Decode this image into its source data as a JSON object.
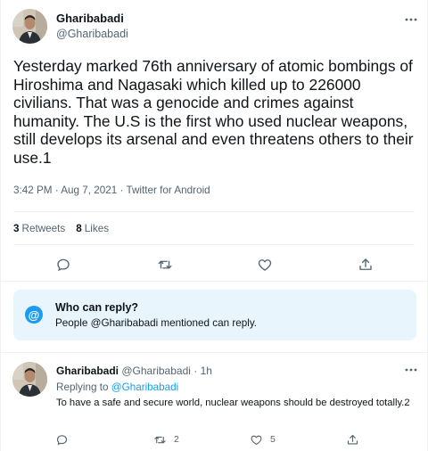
{
  "tweet": {
    "author_name": "Gharibabadi",
    "author_handle": "@Gharibabadi",
    "text": "Yesterday marked 76th anniversary of atomic bombings of Hiroshima and Nagasaki which killed up to 226000 civilians. That was a genocide and crimes against humanity. The U.S is the first who used nuclear weapons, still develops its arsenal and even threatens others to their use.1",
    "timestamp": "3:42 PM · Aug 7, 2021 · Twitter for Android",
    "retweets_count": "3",
    "retweets_label": "Retweets",
    "likes_count": "8",
    "likes_label": "Likes"
  },
  "reply_restriction": {
    "icon": "at-icon",
    "icon_glyph": "@",
    "title": "Who can reply?",
    "subtitle": "People @Gharibabadi mentioned can reply."
  },
  "reply": {
    "author_name": "Gharibabadi",
    "author_handle": "@Gharibabadi",
    "separator": "·",
    "time": "1h",
    "replying_prefix": "Replying to",
    "replying_to": "@Gharibabadi",
    "text": "To have a safe and secure world, nuclear weapons should be destroyed totally.2",
    "retweets_count": "2",
    "likes_count": "5"
  },
  "icons": [
    "avatar",
    "more-icon",
    "reply-icon",
    "retweet-icon",
    "like-icon",
    "share-icon",
    "at-icon"
  ],
  "colors": {
    "accent": "#1d9bf0",
    "secondary_text": "#536471",
    "primary_text": "#0f1419",
    "reply_box_bg": "#e8f5fd",
    "divider": "#eff3f4"
  }
}
